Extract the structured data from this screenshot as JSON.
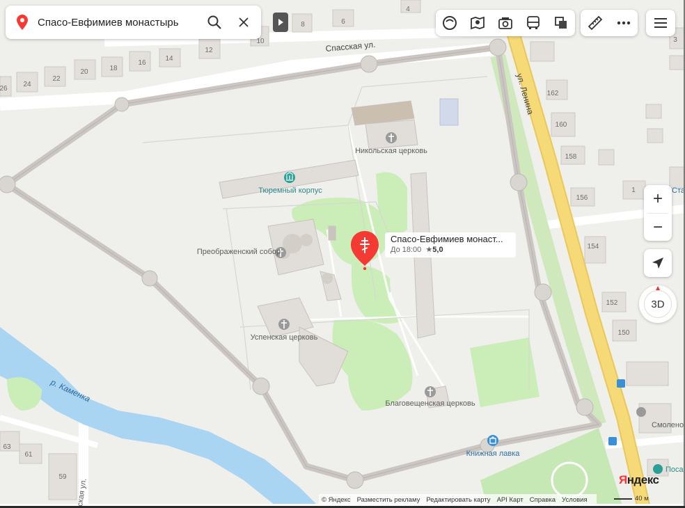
{
  "search": {
    "query": "Спасо-Евфимиев монастырь"
  },
  "poi_popup": {
    "title": "Спасо-Евфимиев монаст...",
    "hours": "До 18:00",
    "rating": "5,0"
  },
  "map_labels": {
    "streets": {
      "spasskaya": "Спасская ул.",
      "lenina": "ул. Ленина",
      "river": "р. Каменка",
      "bottom_street": "ская ул."
    },
    "pois": {
      "nikolskaya": "Никольская церковь",
      "tyuremny": "Тюремный корпус",
      "preobrazhensky": "Преображенский собор",
      "uspenskaya": "Успенская церковь",
      "blagoveshchenskaya": "Благовещенская церковь",
      "knizhnaya": "Книжная лавка",
      "smolen": "Смолено",
      "posad": "Поса",
      "sta": "Ста"
    },
    "house_numbers": [
      "4",
      "8",
      "6",
      "10",
      "12",
      "14",
      "16",
      "18",
      "20",
      "22",
      "24",
      "26",
      "3",
      "162",
      "160",
      "158",
      "156",
      "1",
      "154",
      "152",
      "150",
      "63",
      "61",
      "59"
    ]
  },
  "controls": {
    "zoom_in": "+",
    "zoom_out": "−",
    "compass_label": "3D"
  },
  "footer": {
    "copyright": "© Яндекс",
    "advertise": "Разместить рекламу",
    "edit_map": "Редактировать карту",
    "api": "API Карт",
    "help": "Справка",
    "terms": "Условия",
    "scale": "40 м"
  },
  "brand": {
    "logo_y": "Я",
    "logo_rest": "ндекс"
  },
  "colors": {
    "accent_red": "#f43a32",
    "road_yellow": "#f5d36a",
    "water": "#a8d3f0",
    "green": "#c9ecb8"
  }
}
